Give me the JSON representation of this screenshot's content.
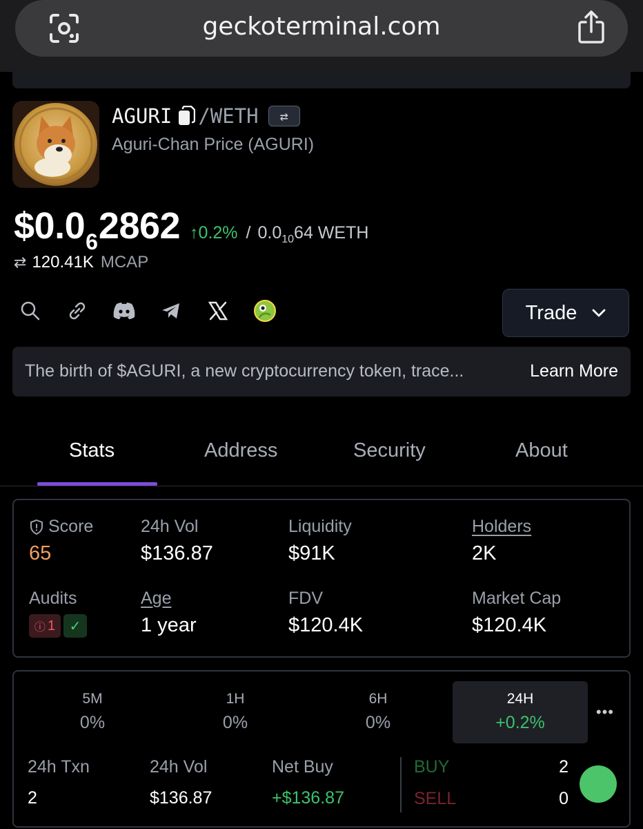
{
  "browser": {
    "url": "geckoterminal.com"
  },
  "token": {
    "base_symbol": "AGURI",
    "quote_symbol": "/WETH",
    "name": "Aguri-Chan Price (AGURI)",
    "price_prefix": "$0.0",
    "price_zero_count": "6",
    "price_digits": "2862",
    "price_change": "↑0.2%",
    "price_sep": "/",
    "weth_prefix": "0.0",
    "weth_zero_count": "10",
    "weth_suffix": "64 WETH",
    "mcap_value": "120.41K",
    "mcap_label": "MCAP"
  },
  "socials": [
    "search-icon",
    "link-icon",
    "discord-icon",
    "telegram-icon",
    "x-icon",
    "coingecko-icon"
  ],
  "trade": {
    "label": "Trade"
  },
  "description": {
    "text": "The birth of $AGURI, a new cryptocurrency token, trace...",
    "learn_more": "Learn More"
  },
  "tabs": [
    {
      "label": "Stats"
    },
    {
      "label": "Address"
    },
    {
      "label": "Security"
    },
    {
      "label": "About"
    }
  ],
  "stats": {
    "score": {
      "label": "Score",
      "value": "65"
    },
    "vol24": {
      "label": "24h Vol",
      "value": "$136.87"
    },
    "liquidity": {
      "label": "Liquidity",
      "value": "$91K"
    },
    "holders": {
      "label": "Holders",
      "value": "2K"
    },
    "audits": {
      "label": "Audits",
      "warn_count": "1",
      "ok": "✓"
    },
    "age": {
      "label": "Age",
      "value": "1 year"
    },
    "fdv": {
      "label": "FDV",
      "value": "$120.4K"
    },
    "market_cap": {
      "label": "Market Cap",
      "value": "$120.4K"
    }
  },
  "timeframes": [
    {
      "label": "5M",
      "value": "0%"
    },
    {
      "label": "1H",
      "value": "0%"
    },
    {
      "label": "6H",
      "value": "0%"
    },
    {
      "label": "24H",
      "value": "+0.2%"
    }
  ],
  "more": "•••",
  "txn": {
    "txn_label": "24h Txn",
    "txn_value": "2",
    "vol_label": "24h Vol",
    "vol_value": "$136.87",
    "netbuy_label": "Net Buy",
    "netbuy_value": "+$136.87",
    "buy_label": "BUY",
    "buy_count": "2",
    "sell_label": "SELL",
    "sell_count": "0"
  },
  "colors": {
    "accent": "#7d4cdb",
    "positive": "#3dc26a",
    "negative": "#f0566a",
    "score": "#f0a061"
  }
}
